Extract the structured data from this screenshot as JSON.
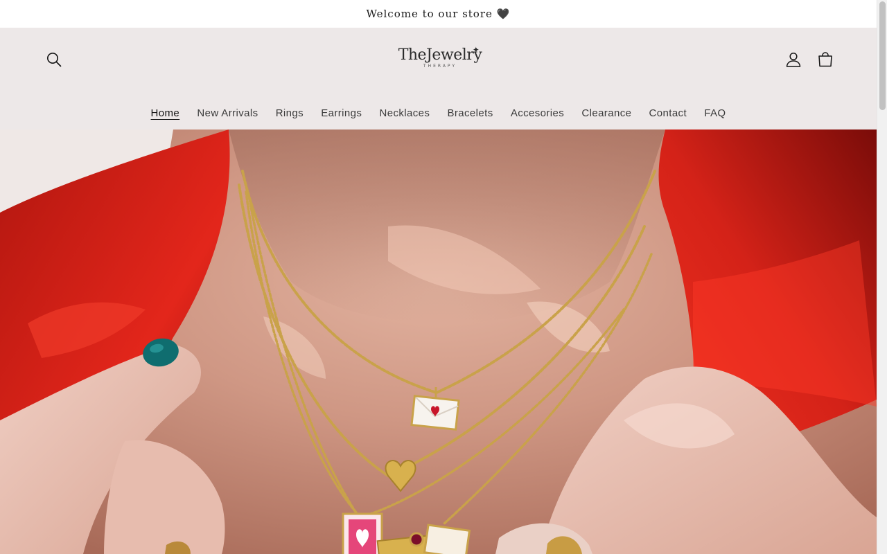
{
  "announcement": {
    "text": "Welcome to our store",
    "emoji": "🖤"
  },
  "header": {
    "logo": {
      "main": "TheJewelry",
      "sub": "THERAPY"
    },
    "icons": {
      "search": "search-icon",
      "account": "account-icon",
      "cart": "cart-icon"
    }
  },
  "nav": {
    "items": [
      {
        "label": "Home",
        "active": true
      },
      {
        "label": "New Arrivals"
      },
      {
        "label": "Rings"
      },
      {
        "label": "Earrings"
      },
      {
        "label": "Necklaces"
      },
      {
        "label": "Bracelets"
      },
      {
        "label": "Accesories"
      },
      {
        "label": "Clearance"
      },
      {
        "label": "Contact"
      },
      {
        "label": "FAQ"
      }
    ]
  },
  "hero": {
    "image": "close-up of woman wearing layered gold necklaces with envelope and heart pendants, red shirt"
  },
  "colors": {
    "header_bg": "#ede8e8",
    "text": "#121212",
    "shirt_red": "#d8251d",
    "gold": "#c9a24a"
  }
}
